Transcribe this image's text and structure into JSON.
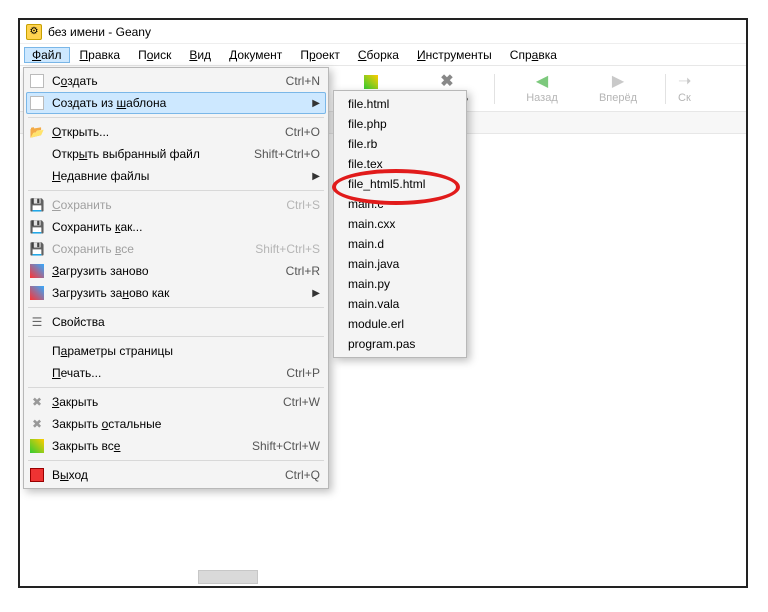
{
  "title": "без имени - Geany",
  "menubar": [
    {
      "label": "Файл",
      "ul": "Ф",
      "active": true
    },
    {
      "label": "Правка",
      "ul": "П"
    },
    {
      "label": "Поиск",
      "ul": "о"
    },
    {
      "label": "Вид",
      "ul": "В"
    },
    {
      "label": "Документ",
      "ul": "Д"
    },
    {
      "label": "Проект",
      "ul": "р"
    },
    {
      "label": "Сборка",
      "ul": "С"
    },
    {
      "label": "Инструменты",
      "ul": "И"
    },
    {
      "label": "Справка",
      "ul": "а"
    }
  ],
  "toolbar": {
    "obscured": "ь",
    "close": "Закрыть",
    "back": "Назад",
    "forward": "Вперёд",
    "jump": "Ск"
  },
  "dropdown": [
    {
      "label": "Создать",
      "ul": "о",
      "shortcut": "Ctrl+N",
      "icon": "new"
    },
    {
      "label": "Создать из шаблона",
      "ul": "ш",
      "arrow": true,
      "icon": "new",
      "highlight": true
    },
    {
      "sep": true
    },
    {
      "label": "Открыть...",
      "ul": "О",
      "shortcut": "Ctrl+O",
      "icon": "open"
    },
    {
      "label": "Открыть выбранный файл",
      "ul": "ы",
      "shortcut": "Shift+Ctrl+O"
    },
    {
      "label": "Недавние файлы",
      "ul": "Н",
      "arrow": true
    },
    {
      "sep": true
    },
    {
      "label": "Сохранить",
      "ul": "С",
      "shortcut": "Ctrl+S",
      "icon": "save",
      "disabled": true
    },
    {
      "label": "Сохранить как...",
      "ul": "к",
      "icon": "save2"
    },
    {
      "label": "Сохранить все",
      "ul": "в",
      "shortcut": "Shift+Ctrl+S",
      "icon": "save3",
      "disabled": true
    },
    {
      "label": "Загрузить заново",
      "ul": "З",
      "shortcut": "Ctrl+R",
      "icon": "reload"
    },
    {
      "label": "Загрузить заново как",
      "ul": "н",
      "arrow": true,
      "icon": "reload2"
    },
    {
      "sep": true
    },
    {
      "label": "Свойства",
      "icon": "props"
    },
    {
      "sep": true
    },
    {
      "label": "Параметры страницы",
      "ul": "а"
    },
    {
      "label": "Печать...",
      "ul": "П",
      "shortcut": "Ctrl+P"
    },
    {
      "sep": true
    },
    {
      "label": "Закрыть",
      "ul": "З",
      "shortcut": "Ctrl+W",
      "icon": "closex"
    },
    {
      "label": "Закрыть остальные",
      "ul": "о",
      "icon": "closex"
    },
    {
      "label": "Закрыть все",
      "ul": "е",
      "shortcut": "Shift+Ctrl+W",
      "icon": "closeall"
    },
    {
      "sep": true
    },
    {
      "label": "Выход",
      "ul": "ы",
      "shortcut": "Ctrl+Q",
      "icon": "exit"
    }
  ],
  "submenu": [
    "file.html",
    "file.php",
    "file.rb",
    "file.tex",
    "file_html5.html",
    "main.c",
    "main.cxx",
    "main.d",
    "main.java",
    "main.py",
    "main.vala",
    "module.erl",
    "program.pas"
  ],
  "annotation_target": "file_html5.html"
}
